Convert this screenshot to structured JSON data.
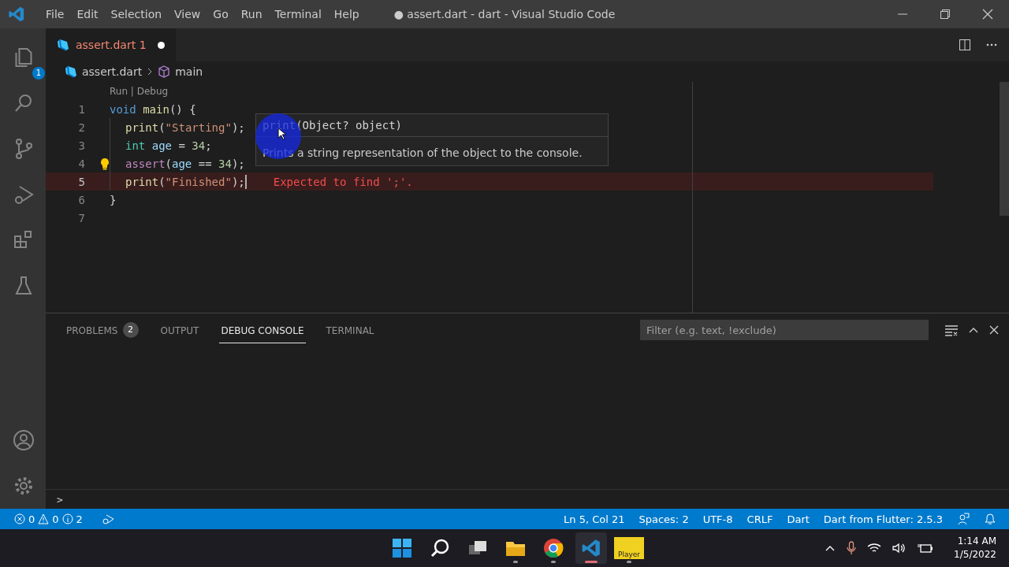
{
  "window": {
    "title": "● assert.dart - dart - Visual Studio Code"
  },
  "menu": [
    "File",
    "Edit",
    "Selection",
    "View",
    "Go",
    "Run",
    "Terminal",
    "Help"
  ],
  "activity_bar": [
    {
      "kind": "files",
      "badge": "1",
      "selected": false
    },
    {
      "kind": "search",
      "selected": false
    },
    {
      "kind": "source-control",
      "selected": false
    },
    {
      "kind": "run-debug",
      "selected": false
    },
    {
      "kind": "extensions",
      "selected": false
    },
    {
      "kind": "testing",
      "selected": false
    }
  ],
  "activity_bottom": [
    {
      "kind": "account"
    },
    {
      "kind": "settings"
    }
  ],
  "editor_tabs": [
    {
      "label": "assert.dart",
      "problems": "1",
      "modified": true,
      "selected": true
    }
  ],
  "breadcrumb": [
    {
      "kind": "file",
      "label": "assert.dart"
    },
    {
      "kind": "symbol",
      "label": "main"
    }
  ],
  "codelens": "Run | Debug",
  "code": [
    {
      "number": "1",
      "current": false,
      "lightbulb": false,
      "indented": false,
      "tokens": [
        {
          "kind": "keyword",
          "text": "void "
        },
        {
          "kind": "fn",
          "text": "main"
        },
        {
          "kind": "plain",
          "text": "() {"
        }
      ]
    },
    {
      "number": "2",
      "current": false,
      "lightbulb": false,
      "indented": true,
      "tokens": [
        {
          "kind": "fn",
          "text": "print"
        },
        {
          "kind": "plain",
          "text": "("
        },
        {
          "kind": "str",
          "text": "\"Starting\""
        },
        {
          "kind": "plain",
          "text": ");"
        }
      ]
    },
    {
      "number": "3",
      "current": false,
      "lightbulb": false,
      "indented": true,
      "tokens": [
        {
          "kind": "type",
          "text": "int "
        },
        {
          "kind": "var",
          "text": "age"
        },
        {
          "kind": "plain",
          "text": " = "
        },
        {
          "kind": "num",
          "text": "34"
        },
        {
          "kind": "plain",
          "text": ";"
        }
      ]
    },
    {
      "number": "4",
      "current": false,
      "lightbulb": true,
      "indented": true,
      "tokens": [
        {
          "kind": "control",
          "text": "assert"
        },
        {
          "kind": "plain",
          "text": "("
        },
        {
          "kind": "var",
          "text": "age"
        },
        {
          "kind": "plain",
          "text": " == "
        },
        {
          "kind": "num",
          "text": "34"
        },
        {
          "kind": "plain",
          "text": ");"
        }
      ]
    },
    {
      "number": "5",
      "current": true,
      "lightbulb": false,
      "indented": true,
      "error": "Expected to find ';'.",
      "tokens": [
        {
          "kind": "fn",
          "text": "print"
        },
        {
          "kind": "plain",
          "text": "("
        },
        {
          "kind": "str",
          "text": "\"Finished\""
        },
        {
          "kind": "plain",
          "text": ");"
        }
      ]
    },
    {
      "number": "6",
      "current": false,
      "lightbulb": false,
      "indented": false,
      "tokens": [
        {
          "kind": "plain",
          "text": "}"
        }
      ]
    },
    {
      "number": "7",
      "current": false,
      "lightbulb": false,
      "indented": false
    }
  ],
  "hover": {
    "name": "print",
    "signature": "(Object? object)",
    "description": "Prints a string representation of the object to the console."
  },
  "panel": {
    "tabs": [
      {
        "label": "PROBLEMS",
        "badge": "2",
        "selected": false
      },
      {
        "label": "OUTPUT",
        "selected": false
      },
      {
        "label": "DEBUG CONSOLE",
        "selected": true
      },
      {
        "label": "TERMINAL",
        "selected": false
      }
    ],
    "filter": {
      "placeholder": "Filter (e.g. text, !exclude)"
    },
    "prompt": ">"
  },
  "status_bar": {
    "errors": "0",
    "warnings": "0",
    "infos": "2",
    "right": [
      "Ln 5, Col 21",
      "Spaces: 2",
      "UTF-8",
      "CRLF",
      "Dart",
      "Dart from Flutter: 2.5.3"
    ]
  },
  "taskbar": {
    "apps": [
      {
        "kind": "start",
        "running": false,
        "selected": false
      },
      {
        "kind": "search",
        "running": false,
        "selected": false
      },
      {
        "kind": "task-view",
        "running": false,
        "selected": false
      },
      {
        "kind": "folder",
        "running": true,
        "selected": false
      },
      {
        "kind": "browser",
        "running": true,
        "selected": false
      },
      {
        "kind": "editor",
        "running": true,
        "selected": true
      },
      {
        "kind": "player",
        "running": true,
        "selected": false,
        "label": "Player"
      }
    ],
    "time": "1:14 AM",
    "date": "1/5/2022"
  }
}
